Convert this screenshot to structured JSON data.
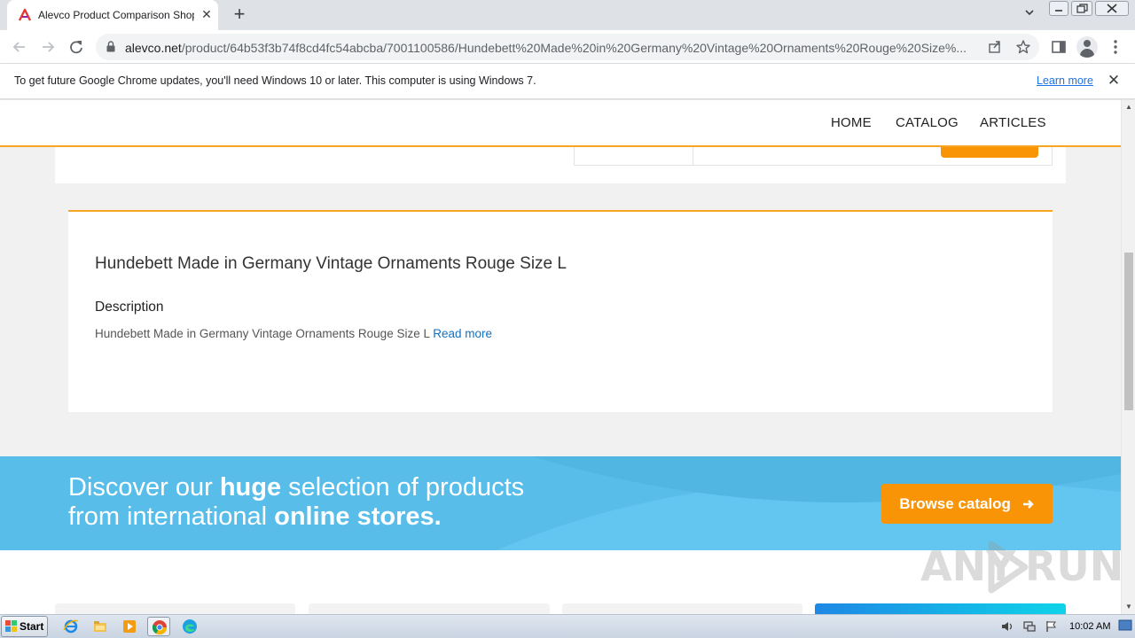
{
  "browser": {
    "tab_title": "Alevco Product Comparison Shopping",
    "tab_close": "✕",
    "new_tab": "+",
    "url_host": "alevco.net",
    "url_path": "/product/64b53f3b74f8cd4fc54abcba/7001100586/Hundebett%20Made%20in%20Germany%20Vintage%20Ornaments%20Rouge%20Size%..."
  },
  "infobar": {
    "message": "To get future Google Chrome updates, you'll need Windows 10 or later. This computer is using Windows 7.",
    "link": "Learn more",
    "close": "✕"
  },
  "site_nav": {
    "items": [
      "HOME",
      "CATALOG",
      "ARTICLES"
    ]
  },
  "product": {
    "title": "Hundebett Made in Germany Vintage Ornaments Rouge Size L",
    "description_heading": "Description",
    "description_text": "Hundebett Made in Germany Vintage Ornaments Rouge Size L",
    "read_more": "Read more"
  },
  "banner": {
    "line1_pre": "Discover our ",
    "line1_bold": "huge",
    "line1_post": " selection of products",
    "line2_pre": "from international ",
    "line2_bold": "online stores.",
    "button": "Browse catalog"
  },
  "watermark": {
    "left": "ANY",
    "right": "RUN"
  },
  "taskbar": {
    "start": "Start",
    "clock": "10:02 AM"
  },
  "colors": {
    "accent_orange": "#f89406",
    "banner_blue": "#58bde9",
    "link_blue": "#1172c2"
  }
}
